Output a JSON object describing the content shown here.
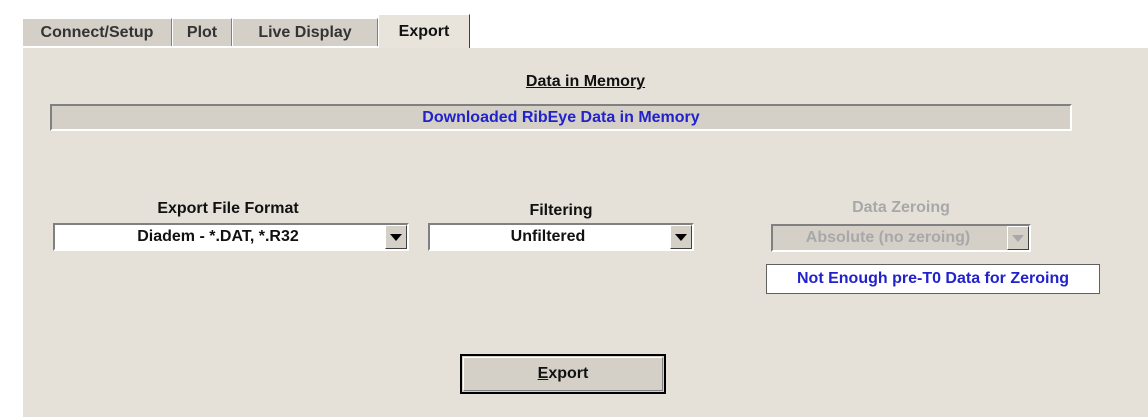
{
  "tabs": [
    {
      "label": "Connect/Setup",
      "active": false
    },
    {
      "label": "Plot",
      "active": false
    },
    {
      "label": "Live Display",
      "active": false
    },
    {
      "label": "Export",
      "active": true
    }
  ],
  "memory": {
    "title": "Data in Memory",
    "status": "Downloaded RibEye Data in Memory"
  },
  "export_format": {
    "label": "Export File Format",
    "selected": "Diadem - *.DAT, *.R32"
  },
  "filtering": {
    "label": "Filtering",
    "selected": "Unfiltered"
  },
  "zeroing": {
    "label": "Data Zeroing",
    "selected": "Absolute (no zeroing)",
    "enabled": false,
    "warning": "Not Enough pre-T0 Data for Zeroing"
  },
  "export_button": {
    "mnemonic": "E",
    "rest": "xport"
  },
  "colors": {
    "panel": "#e5e1d9",
    "status_text": "#2222cc",
    "disabled_text": "#a8a8a8"
  }
}
